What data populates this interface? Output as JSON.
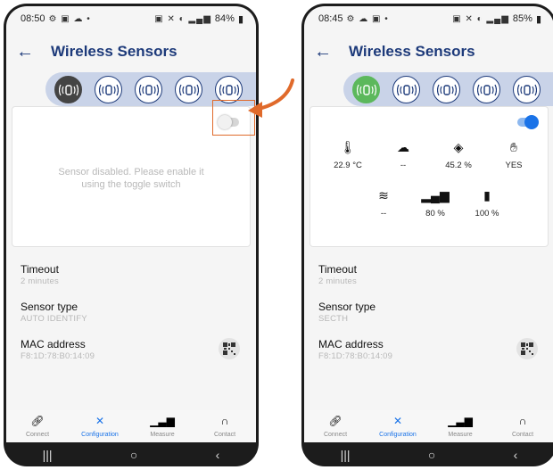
{
  "left": {
    "status": {
      "time": "08:50",
      "battery": "84%"
    },
    "title": "Wireless Sensors",
    "toggle_state": "off",
    "disabled_message": "Sensor disabled. Please enable it using the toggle switch",
    "settings": [
      {
        "label": "Timeout",
        "value": "2 minutes"
      },
      {
        "label": "Sensor type",
        "value": "AUTO IDENTIFY"
      },
      {
        "label": "MAC address",
        "value": "F8:1D:78:B0:14:09"
      }
    ],
    "nav": [
      "Connect",
      "Configuration",
      "Measure",
      "Contact"
    ]
  },
  "right": {
    "status": {
      "time": "08:45",
      "battery": "85%"
    },
    "title": "Wireless Sensors",
    "toggle_state": "on",
    "measurements_row1": [
      {
        "icon": "thermometer-icon",
        "value": "22.9 °C"
      },
      {
        "icon": "co2-cloud-icon",
        "value": "--"
      },
      {
        "icon": "humidity-drop-icon",
        "value": "45.2 %"
      },
      {
        "icon": "motion-hand-icon",
        "value": "YES"
      }
    ],
    "measurements_row2": [
      {
        "icon": "wind-icon",
        "value": "--"
      },
      {
        "icon": "signal-bars-icon",
        "value": "80 %"
      },
      {
        "icon": "battery-icon",
        "value": "100 %"
      }
    ],
    "settings": [
      {
        "label": "Timeout",
        "value": "2 minutes"
      },
      {
        "label": "Sensor type",
        "value": "SECTH"
      },
      {
        "label": "MAC address",
        "value": "F8:1D:78:B0:14:09"
      }
    ],
    "nav": [
      "Connect",
      "Configuration",
      "Measure",
      "Contact"
    ]
  },
  "colors": {
    "title": "#1d3a7a",
    "active_nav": "#1a73e8",
    "sensor_active_left": "#444444",
    "sensor_active_right": "#5cb85c",
    "toggle_on": "#1a73e8",
    "highlight": "#e06a2b"
  }
}
